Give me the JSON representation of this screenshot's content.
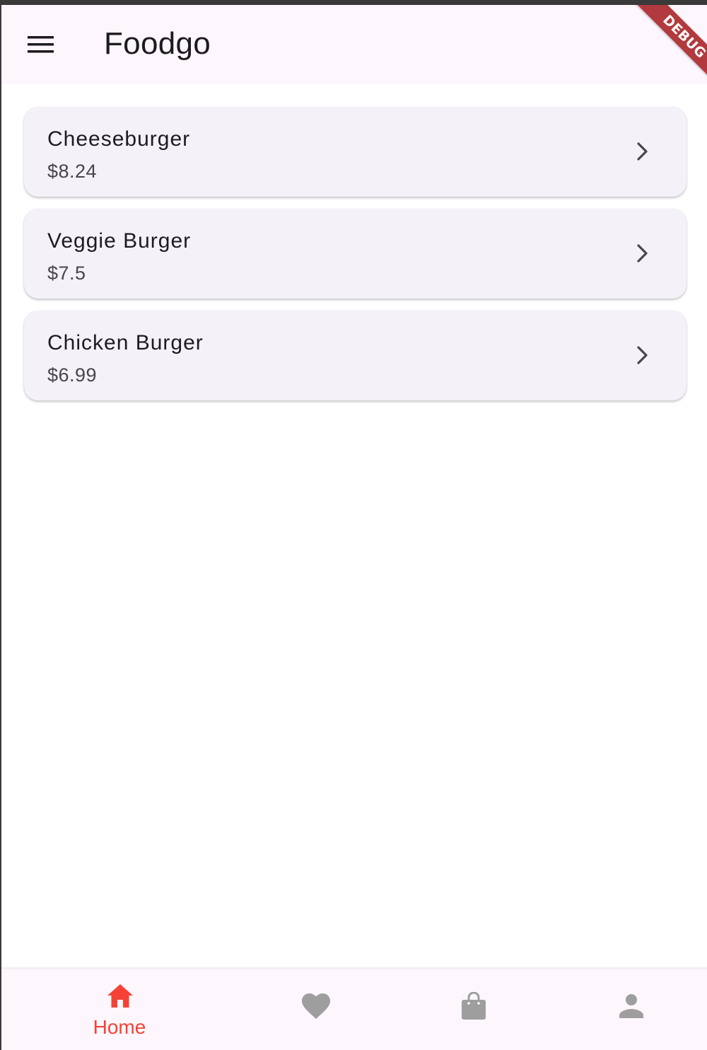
{
  "appbar": {
    "title": "Foodgo",
    "menu_icon": "hamburger-menu-icon",
    "debug_banner": "DEBUG"
  },
  "menu": {
    "items": [
      {
        "name": "Cheeseburger",
        "price": "$8.24"
      },
      {
        "name": "Veggie Burger",
        "price": "$7.5"
      },
      {
        "name": "Chicken Burger",
        "price": "$6.99"
      }
    ],
    "chevron_icon": "chevron-right-icon"
  },
  "bottom_nav": {
    "selected_index": 0,
    "items": [
      {
        "label": "Home",
        "icon": "home-icon"
      },
      {
        "label": "",
        "icon": "heart-icon"
      },
      {
        "label": "",
        "icon": "shopping-bag-icon"
      },
      {
        "label": "",
        "icon": "person-icon"
      }
    ]
  },
  "colors": {
    "accent": "#f44336",
    "inactive_icon": "#9e9e9e",
    "appbar_bg": "#fdf6fd",
    "card_bg": "#f5f1f8",
    "debug_ribbon": "#b23a3e"
  }
}
